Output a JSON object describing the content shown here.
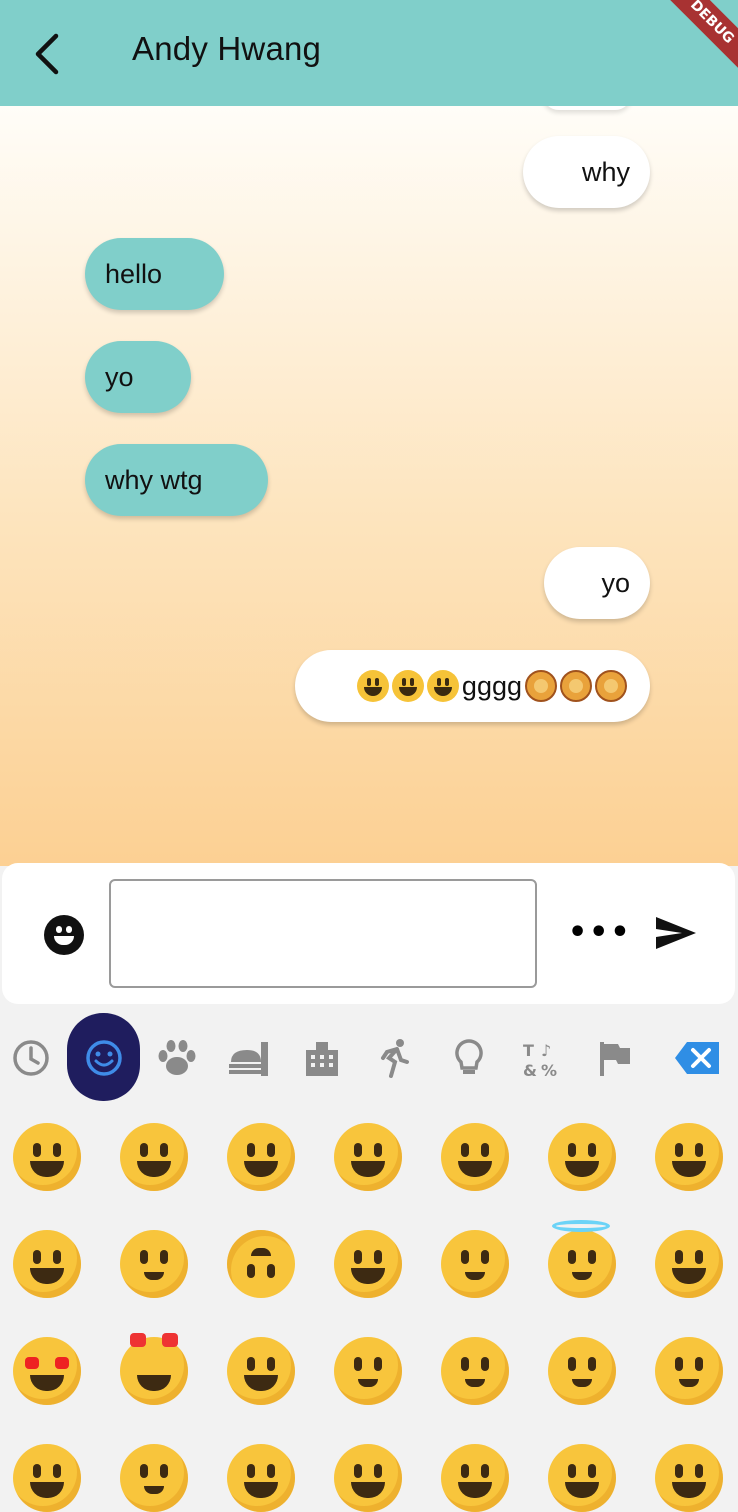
{
  "appbar": {
    "title": "Andy Hwang",
    "debug_label": "DEBUG"
  },
  "messages": [
    {
      "side": "out",
      "text": "why"
    },
    {
      "side": "in",
      "text": "hello"
    },
    {
      "side": "in",
      "text": "yo"
    },
    {
      "side": "in",
      "text": "why wtg"
    },
    {
      "side": "out",
      "text": "yo"
    },
    {
      "side": "out",
      "text_middle": "gggg",
      "leading_emojis": [
        "smiley",
        "smiley",
        "smiley"
      ],
      "trailing_emojis": [
        "lion",
        "lion",
        "lion"
      ]
    }
  ],
  "input": {
    "value": "",
    "more_label": "•••"
  },
  "emoji_tabs": [
    "recent-icon",
    "smileys-icon",
    "animals-icon",
    "food-icon",
    "travel-icon",
    "activities-icon",
    "objects-icon",
    "symbols-icon",
    "flags-icon",
    "backspace-icon"
  ],
  "emoji_tab_active": "smileys-icon",
  "colors": {
    "appbar": "#80cfca",
    "incoming_bubble": "#80cfca",
    "outgoing_bubble": "#ffffff",
    "active_tab": "#1f1d5e",
    "backspace": "#2f8ee5"
  },
  "emoji_grid": [
    [
      "grinning",
      "smiley",
      "smile",
      "grin",
      "laughing",
      "sweat-smile",
      "rofl"
    ],
    [
      "joy",
      "slight-smile",
      "upside-down",
      "wink",
      "blush",
      "innocent",
      "smiling-hearts"
    ],
    [
      "heart-eyes",
      "star-struck",
      "kissing-heart",
      "kissing",
      "relaxed",
      "kissing-closed-eyes",
      "kissing-smiling-eyes"
    ],
    [
      "yum",
      "stuck-out-tongue",
      "winking-tongue",
      "zany",
      "squinting-tongue",
      "money-mouth",
      "hugging"
    ]
  ]
}
